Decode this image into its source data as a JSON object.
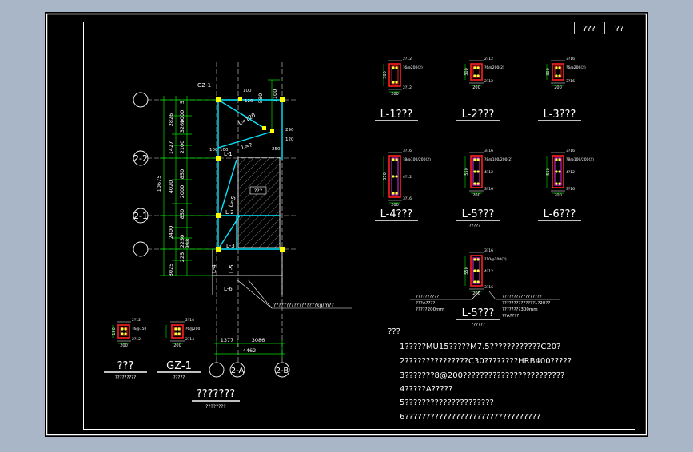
{
  "title_block": {
    "cell1": "??? ",
    "cell2": "??"
  },
  "axes": {
    "left": [
      "2-2",
      "2-1"
    ],
    "bottom": [
      "2-A",
      "2-B"
    ]
  },
  "plan": {
    "room_label": "???",
    "gz_label": "GZ-1",
    "beams": [
      "L-1",
      "L-2",
      "L-3",
      "L-4",
      "L-5",
      "L-6"
    ],
    "load_note": "?????????????????kg/m??",
    "dims_left_outer": [
      "10675",
      "1427",
      "4020",
      "2400",
      "3025"
    ],
    "dims_left_inner": [
      "5",
      "2826",
      "3260",
      "1000",
      "850",
      "2000",
      "850",
      "2100",
      "2250",
      "998",
      "225"
    ],
    "dims_top": [
      "1100",
      "580"
    ],
    "dims_bottom": [
      "1377",
      "3086",
      "4462"
    ],
    "small_dims": [
      "100",
      "100",
      "120",
      "120",
      "250",
      "290",
      "100"
    ],
    "diag_labels": [
      "L=120",
      "L=?",
      "L=5"
    ]
  },
  "sections": [
    {
      "label": "L-1???",
      "h": "300",
      "b": "200",
      "top": "2?12",
      "bot": "2?12",
      "stir": "?6@200(2)"
    },
    {
      "label": "L-2???",
      "h": "300",
      "b": "200",
      "top": "2?12",
      "bot": "2?12",
      "stir": "?6@200(2)"
    },
    {
      "label": "L-3???",
      "h": "300",
      "b": "200",
      "top": "3?16",
      "bot": "3?16",
      "stir": "?6@200(2)"
    },
    {
      "label": "L-4???",
      "h": "550",
      "b": "200",
      "top": "3?16",
      "bot": "3?16",
      "stir": "?8@100/200(2)",
      "mid": "4?12"
    },
    {
      "label": "L-5???",
      "h": "550",
      "b": "200",
      "top": "3?16",
      "bot": "3?16",
      "stir": "?8@100/200(2)",
      "mid": "4?12"
    },
    {
      "label": "L-6???",
      "h": "550",
      "b": "200",
      "top": "3?16",
      "bot": "3?16",
      "stir": "?8@100/200(2)",
      "mid": "4?12"
    }
  ],
  "sections_sub": "?????",
  "l5b": {
    "label": "L-5???",
    "sub": "??????",
    "h": "550",
    "b": "200",
    "top": "3?16",
    "bot": "3?16",
    "stir": "?10@100(2)",
    "mid": "4?12",
    "note_left": [
      "??????????",
      "???A????",
      "?????200mm"
    ],
    "note_right": [
      "?????????????????",
      "??????????????1?20??",
      "????????300mm",
      "??A????"
    ]
  },
  "small_sections": [
    {
      "label": "???",
      "sub": "?????????",
      "h": "180",
      "b": "200",
      "top": "2?12",
      "bot": "2?12",
      "stir": "?6@150"
    },
    {
      "label": "GZ-1",
      "sub": "?????",
      "h": "",
      "b": "200",
      "top": "2?14",
      "bot": "2?14",
      "stir": "?6@200"
    }
  ],
  "plan_title": "???????",
  "plan_sub": "????????",
  "notes_heading": "???",
  "notes": [
    "1?????MU15?????M7.5????????????C20?",
    "2???????????????C30????????HRB400?????",
    "3???????8@200????????????????????????",
    "4?????A?????",
    "5?????????????????????",
    "6????????????????????????????????"
  ]
}
